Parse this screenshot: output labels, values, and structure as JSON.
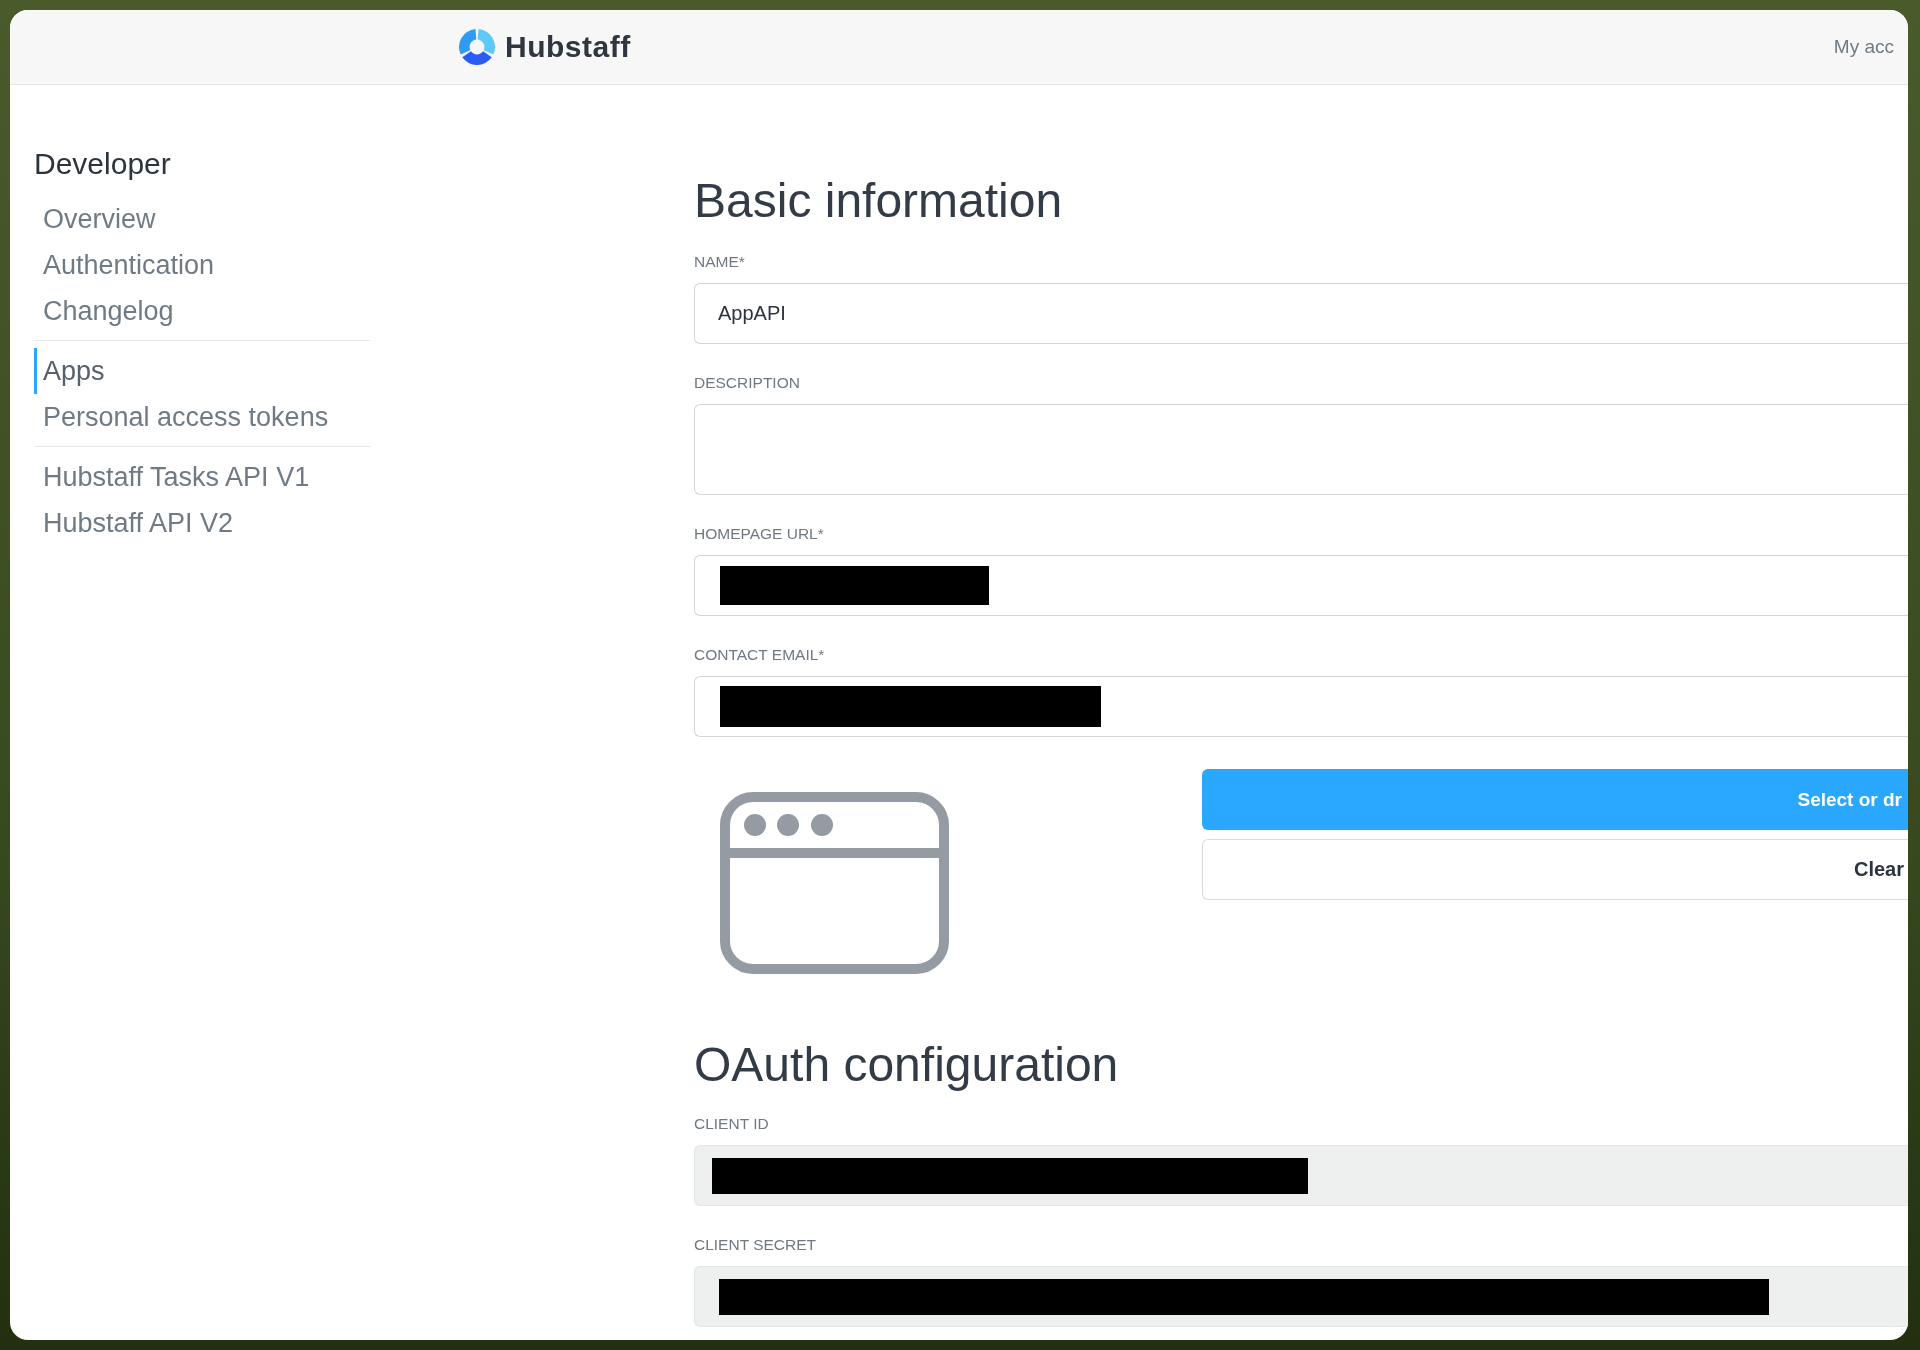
{
  "header": {
    "brand": "Hubstaff",
    "account_link": "My acc"
  },
  "sidebar": {
    "title": "Developer",
    "groups": [
      {
        "items": [
          {
            "label": "Overview",
            "selected": false
          },
          {
            "label": "Authentication",
            "selected": false
          },
          {
            "label": "Changelog",
            "selected": false
          }
        ]
      },
      {
        "items": [
          {
            "label": "Apps",
            "selected": true
          },
          {
            "label": "Personal access tokens",
            "selected": false
          }
        ]
      },
      {
        "items": [
          {
            "label": "Hubstaff Tasks API V1",
            "selected": false
          },
          {
            "label": "Hubstaff API V2",
            "selected": false
          }
        ]
      }
    ]
  },
  "basic_information": {
    "title": "Basic information",
    "fields": [
      {
        "label": "NAME*",
        "kind": "input",
        "value": "AppAPI",
        "readonly": false,
        "redacted": false
      },
      {
        "label": "DESCRIPTION",
        "kind": "textarea",
        "readonly": false,
        "redacted": false
      },
      {
        "label": "HOMEPAGE URL*",
        "kind": "input",
        "readonly": false,
        "redacted": true
      },
      {
        "label": "CONTACT EMAIL*",
        "kind": "input",
        "readonly": false,
        "redacted": true
      }
    ],
    "logo_upload": {
      "buttons": [
        {
          "label": "Select or dr",
          "kind": "primary"
        },
        {
          "label": "Clear",
          "kind": "secondary"
        }
      ]
    }
  },
  "oauth_configuration": {
    "title": "OAuth configuration",
    "fields": [
      {
        "label": "CLIENT ID",
        "kind": "input",
        "readonly": true,
        "redacted": true
      },
      {
        "label": "CLIENT SECRET",
        "kind": "input",
        "readonly": true,
        "redacted": true
      }
    ]
  }
}
